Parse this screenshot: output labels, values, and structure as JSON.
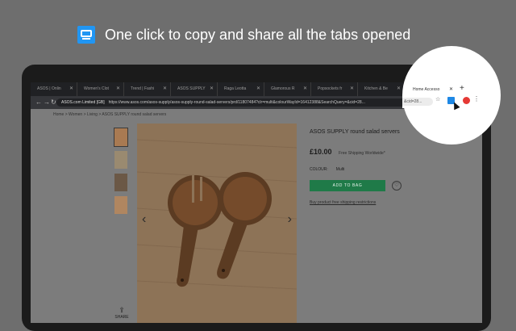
{
  "promo": {
    "text": "One click to copy and share all the tabs opened",
    "icon": "tabs-copy-icon"
  },
  "tabs": [
    {
      "label": "ASOS | Onlin"
    },
    {
      "label": "Women's Clot"
    },
    {
      "label": "Trend | Fashi"
    },
    {
      "label": "ASOS SUPPLY"
    },
    {
      "label": "Raga Leotta"
    },
    {
      "label": "Glamorous R"
    },
    {
      "label": "Popsockets fr"
    },
    {
      "label": "Kitchen & Be"
    },
    {
      "label": "Home Accesso"
    }
  ],
  "address": {
    "secure_label": "ASOS.com Limited [GB]",
    "url": "https://www.asos.com/asos-supply/asos-supply-round-salad-servers/prd/11807484?clr=multi&colourWayId=16412388&SearchQuery=&cid=28..."
  },
  "breadcrumb": {
    "home": "Home",
    "women": "Women",
    "living": "Living",
    "current": "ASOS SUPPLY round salad servers"
  },
  "product": {
    "title": "ASOS SUPPLY round salad servers",
    "price": "£10.00",
    "shipping": "Free Shipping Worldwide*",
    "colour_label": "COLOUR:",
    "colour_value": "Multi",
    "add_to_bag": "ADD TO BAG",
    "shipping_link": "Buy product free shipping restrictions"
  },
  "share_label": "SHARE",
  "colors": {
    "accent": "#1f7a48",
    "extension": "#1e88e5",
    "promo_icon": "#2196f3"
  }
}
